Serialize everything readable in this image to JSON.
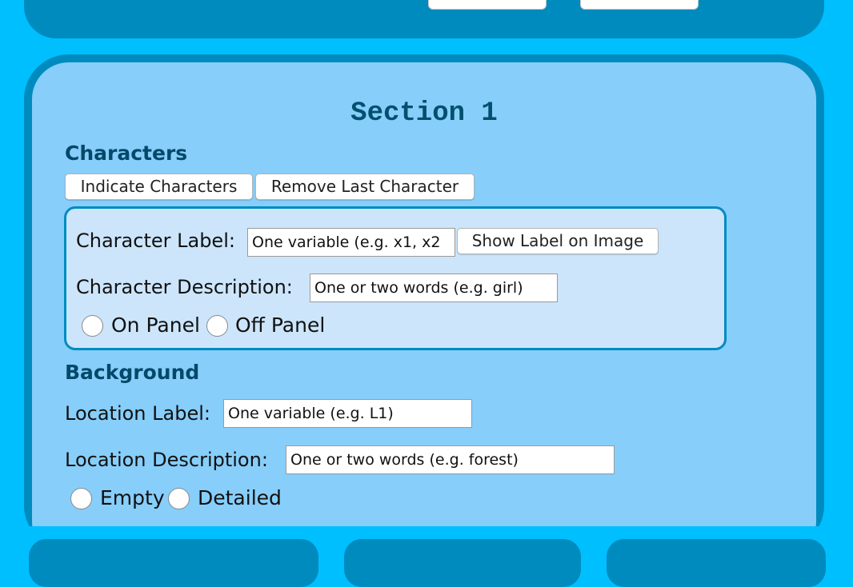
{
  "section": {
    "title": "Section 1"
  },
  "characters": {
    "heading": "Characters",
    "indicate_button": "Indicate Characters",
    "remove_button": "Remove Last Character",
    "label_text": "Character Label:",
    "label_placeholder": "One variable (e.g. x1, x2",
    "show_label_button": "Show Label on Image",
    "description_text": "Character Description:",
    "description_placeholder": "One or two words (e.g. girl)",
    "radio_on_panel": "On Panel",
    "radio_off_panel": "Off Panel"
  },
  "background": {
    "heading": "Background",
    "location_label_text": "Location Label:",
    "location_label_placeholder": "One variable (e.g. L1)",
    "location_description_text": "Location Description:",
    "location_description_placeholder": "One or two words (e.g. forest)",
    "radio_empty": "Empty",
    "radio_detailed": "Detailed"
  },
  "colors": {
    "page_background": "#00bfff",
    "panel_dark": "#008bbf",
    "section_fill": "#87cefa",
    "character_box_fill": "#cce5fb",
    "heading_text": "#04486a"
  }
}
